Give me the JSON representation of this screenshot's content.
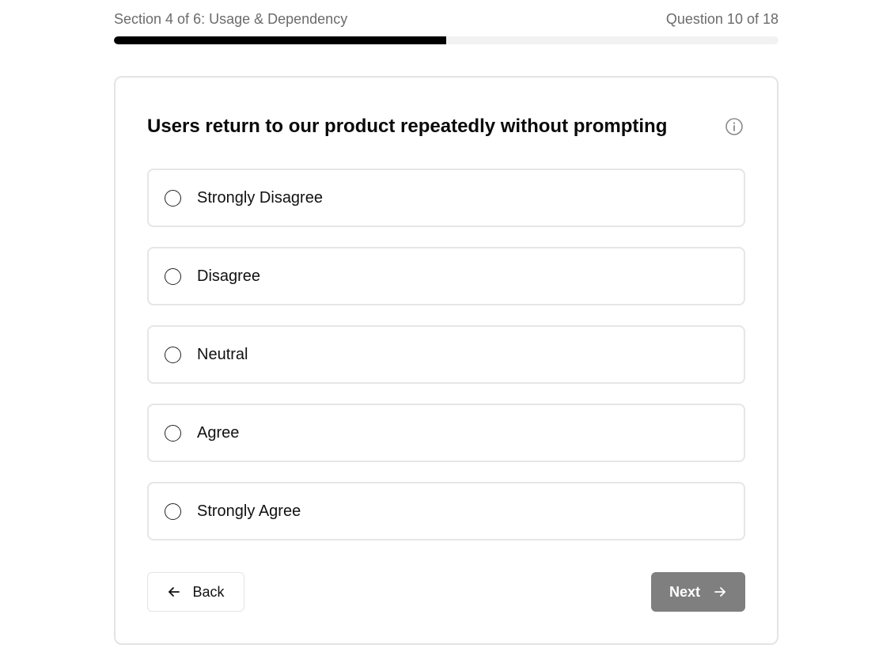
{
  "header": {
    "section_label": "Section 4 of 6: Usage & Dependency",
    "question_counter": "Question 10 of 18",
    "progress_fraction": 0.5
  },
  "question": {
    "title": "Users return to our product repeatedly without prompting",
    "info_icon": "info-circle-icon"
  },
  "options": [
    {
      "label": "Strongly Disagree",
      "selected": false
    },
    {
      "label": "Disagree",
      "selected": false
    },
    {
      "label": "Neutral",
      "selected": false
    },
    {
      "label": "Agree",
      "selected": false
    },
    {
      "label": "Strongly Agree",
      "selected": false
    }
  ],
  "navigation": {
    "back_label": "Back",
    "back_icon": "arrow-left-icon",
    "next_label": "Next",
    "next_icon": "arrow-right-icon",
    "next_enabled": false
  },
  "colors": {
    "progress_fill": "#000000",
    "progress_track": "#f2f2f2",
    "next_button_disabled": "#7f7f7f"
  }
}
